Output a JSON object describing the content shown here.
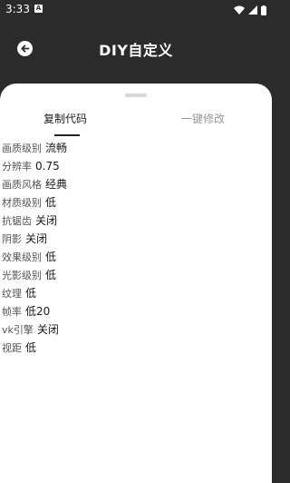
{
  "status_bar": {
    "time": "3:33",
    "app_icon_letter": "A"
  },
  "header": {
    "title": "DIY自定义"
  },
  "tabs": [
    {
      "label": "复制代码",
      "active": true
    },
    {
      "label": "一键修改",
      "active": false
    }
  ],
  "settings": [
    {
      "label": "画质级别",
      "value": "流畅"
    },
    {
      "label": "分辨率",
      "value": "0.75"
    },
    {
      "label": "画质风格",
      "value": "经典"
    },
    {
      "label": "材质级别",
      "value": "低"
    },
    {
      "label": "抗锯齿",
      "value": "关闭"
    },
    {
      "label": "阴影",
      "value": "关闭"
    },
    {
      "label": "效果级别",
      "value": "低"
    },
    {
      "label": "光影级别",
      "value": "低"
    },
    {
      "label": "纹理",
      "value": "低"
    },
    {
      "label": "帧率",
      "value": "低20"
    },
    {
      "label": "vk引擎",
      "value": "关闭"
    },
    {
      "label": "视距",
      "value": "低"
    }
  ],
  "colors": {
    "header_bg": "#2b2b2b",
    "sheet_bg": "#ffffff",
    "active_tab": "#222222",
    "inactive_tab": "#999999"
  },
  "icons": {
    "back": "arrow-left-circle-icon",
    "wifi": "wifi-icon",
    "signal": "signal-icon",
    "battery": "battery-icon"
  }
}
